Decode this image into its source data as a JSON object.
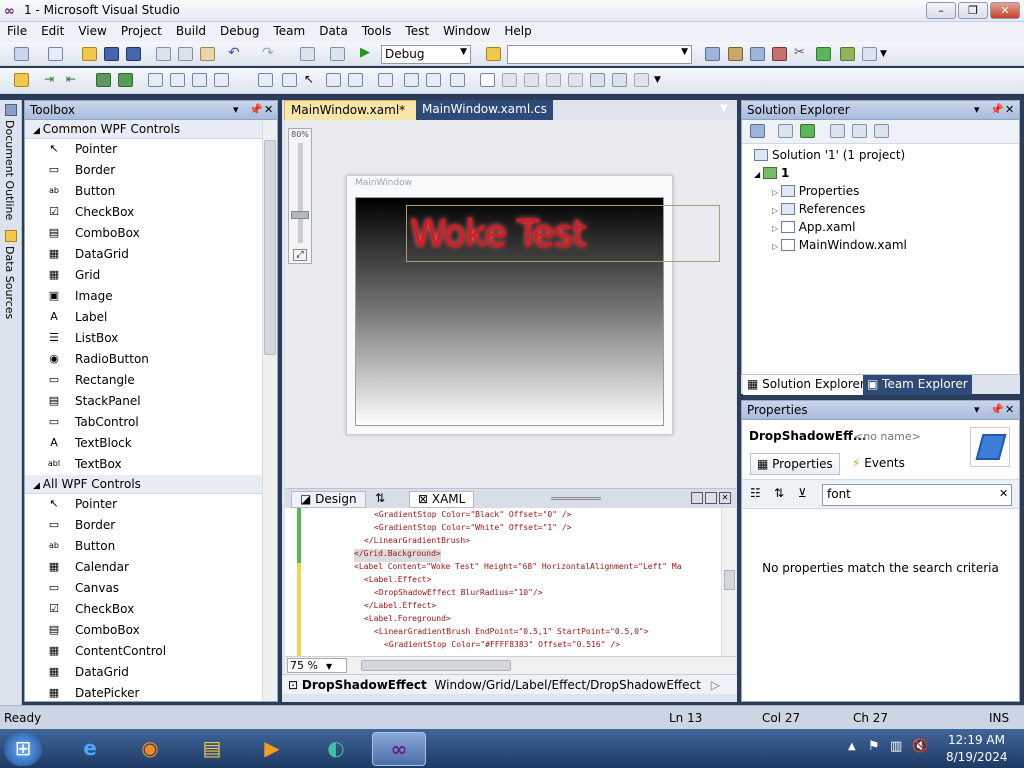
{
  "window": {
    "title": "1 - Microsoft Visual Studio",
    "minimize": "–",
    "restore": "❐",
    "close": "✕"
  },
  "menu": [
    "File",
    "Edit",
    "View",
    "Project",
    "Build",
    "Debug",
    "Team",
    "Data",
    "Tools",
    "Test",
    "Window",
    "Help"
  ],
  "toolbar": {
    "config": "Debug",
    "platform": ""
  },
  "left_strip": {
    "doc_outline": "Document Outline",
    "data_sources": "Data Sources"
  },
  "toolbox": {
    "title": "Toolbox",
    "group1": "Common WPF Controls",
    "items1": [
      "Pointer",
      "Border",
      "Button",
      "CheckBox",
      "ComboBox",
      "DataGrid",
      "Grid",
      "Image",
      "Label",
      "ListBox",
      "RadioButton",
      "Rectangle",
      "StackPanel",
      "TabControl",
      "TextBlock",
      "TextBox"
    ],
    "group2": "All WPF Controls",
    "items2": [
      "Pointer",
      "Border",
      "Button",
      "Calendar",
      "Canvas",
      "CheckBox",
      "ComboBox",
      "ContentControl",
      "DataGrid",
      "DatePicker"
    ]
  },
  "editor": {
    "tab_active": "MainWindow.xaml*",
    "tab_inactive": "MainWindow.xaml.cs",
    "zoom_pct": "80%",
    "window_title": "MainWindow",
    "label_text": "Woke Test",
    "design_tab": "Design",
    "swap": "⇅",
    "xaml_tab": "XAML",
    "zoom_combo": "75 %",
    "code_lines": [
      {
        "indent": 13,
        "text": "<GradientStop Color=\"Black\" Offset=\"0\" />"
      },
      {
        "indent": 13,
        "text": "<GradientStop Color=\"White\" Offset=\"1\" />"
      },
      {
        "indent": 11,
        "text": "</LinearGradientBrush>"
      },
      {
        "indent": 9,
        "text": "</Grid.Background>"
      },
      {
        "indent": 9,
        "text": "<Label Content=\"Woke Test\" Height=\"68\" HorizontalAlignment=\"Left\" Ma"
      },
      {
        "indent": 11,
        "text": "<Label.Effect>"
      },
      {
        "indent": 13,
        "text": "<DropShadowEffect BlurRadius=\"10\"/>"
      },
      {
        "indent": 11,
        "text": "</Label.Effect>"
      },
      {
        "indent": 11,
        "text": "<Label.Foreground>"
      },
      {
        "indent": 13,
        "text": "<LinearGradientBrush EndPoint=\"0.5,1\" StartPoint=\"0.5,0\">"
      },
      {
        "indent": 15,
        "text": "<GradientStop Color=\"#FFFF8383\" Offset=\"0.516\" />"
      }
    ],
    "breadcrumb_bold": "DropShadowEffect",
    "breadcrumb_path": "Window/Grid/Label/Effect/DropShadowEffect"
  },
  "solution_explorer": {
    "title": "Solution Explorer",
    "solution": "Solution '1' (1 project)",
    "project": "1",
    "nodes": [
      "Properties",
      "References",
      "App.xaml",
      "MainWindow.xaml"
    ],
    "tab1": "Solution Explorer",
    "tab2": "Team Explorer"
  },
  "properties": {
    "title": "Properties",
    "object": "DropShadowEff...",
    "name": "<no name>",
    "tab_props": "Properties",
    "tab_events": "Events",
    "search_value": "font",
    "empty_msg": "No properties match the search criteria"
  },
  "status": {
    "ready": "Ready",
    "ln": "Ln 13",
    "col": "Col 27",
    "ch": "Ch 27",
    "ins": "INS"
  },
  "clock": {
    "time": "12:19 AM",
    "date": "8/19/2024"
  }
}
